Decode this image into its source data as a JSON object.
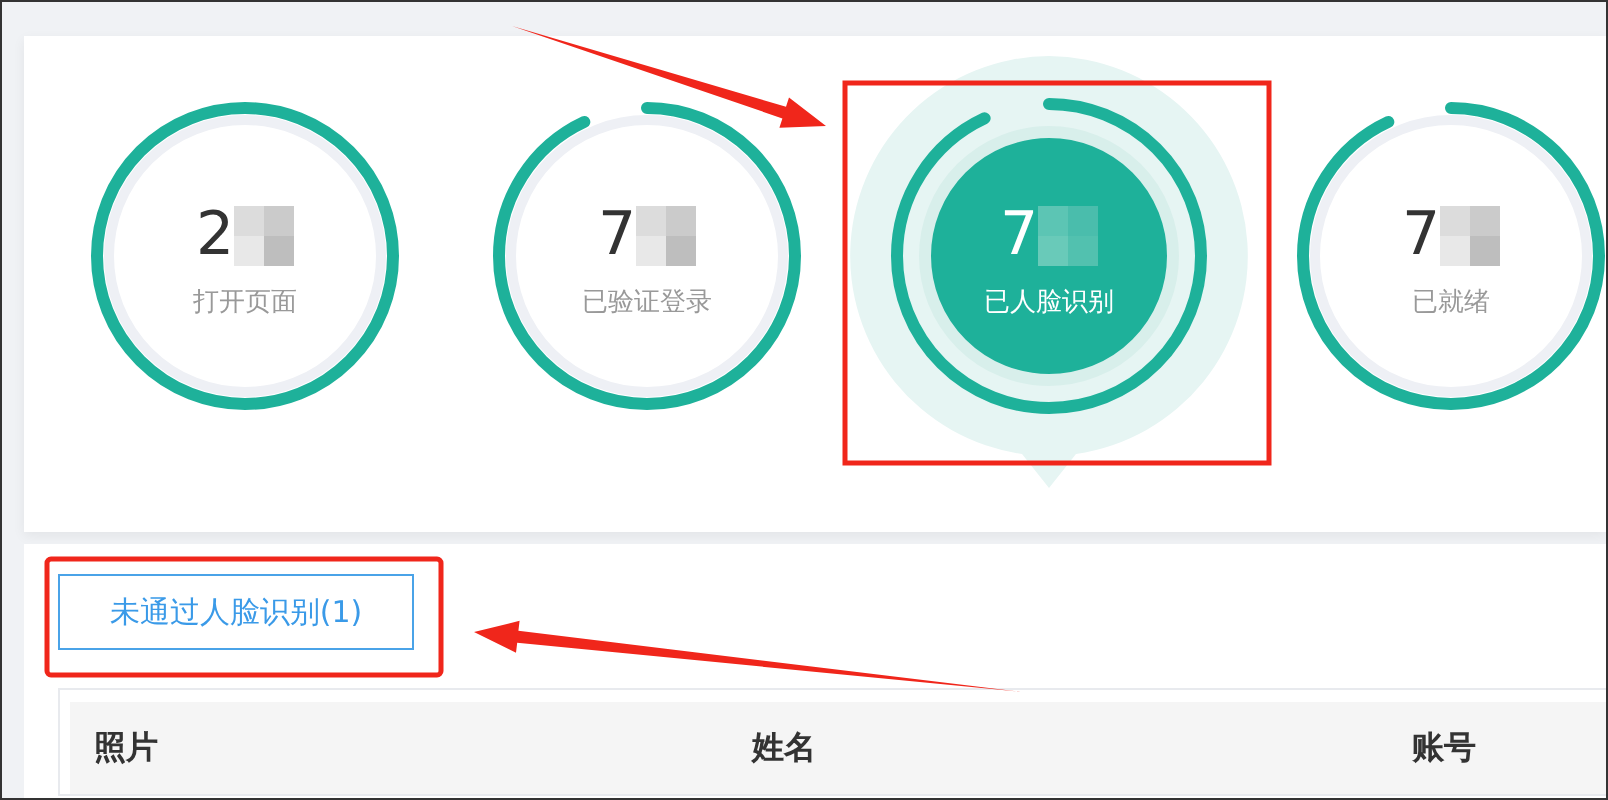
{
  "stats": [
    {
      "value": "2",
      "label": "打开页面",
      "level": 1,
      "selected": false
    },
    {
      "value": "7",
      "label": "已验证登录",
      "level": 0.93,
      "selected": false
    },
    {
      "value": "7",
      "label": "已人脸识别",
      "level": 0.93,
      "selected": true
    },
    {
      "value": "7",
      "label": "已就绪",
      "level": 0.93,
      "selected": false
    }
  ],
  "tab": {
    "label": "未通过人脸识别(1)",
    "selected": true
  },
  "table": {
    "columns": [
      "照片",
      "姓名",
      "账号"
    ]
  }
}
